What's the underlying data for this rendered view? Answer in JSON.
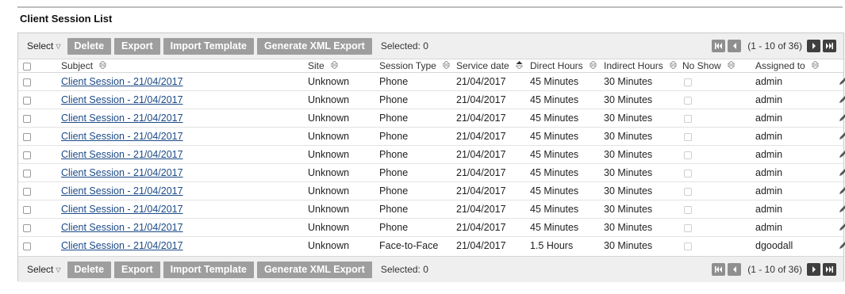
{
  "page": {
    "title": "Client Session List"
  },
  "toolbar": {
    "select_label": "Select",
    "delete_label": "Delete",
    "export_label": "Export",
    "import_label": "Import Template",
    "xml_export_label": "Generate XML Export",
    "selected_text": "Selected: 0"
  },
  "pager": {
    "range_text": "(1 - 10 of 36)"
  },
  "columns": {
    "subject": "Subject",
    "site": "Site",
    "session_type": "Session Type",
    "service_date": "Service date",
    "direct_hours": "Direct Hours",
    "indirect_hours": "Indirect Hours",
    "no_show": "No Show",
    "assigned_to": "Assigned to"
  },
  "rows": [
    {
      "subject": "Client Session - 21/04/2017",
      "site": "Unknown",
      "session_type": "Phone",
      "service_date": "21/04/2017",
      "direct_hours": "45 Minutes",
      "indirect_hours": "30 Minutes",
      "assigned_to": "admin"
    },
    {
      "subject": "Client Session - 21/04/2017",
      "site": "Unknown",
      "session_type": "Phone",
      "service_date": "21/04/2017",
      "direct_hours": "45 Minutes",
      "indirect_hours": "30 Minutes",
      "assigned_to": "admin"
    },
    {
      "subject": "Client Session - 21/04/2017",
      "site": "Unknown",
      "session_type": "Phone",
      "service_date": "21/04/2017",
      "direct_hours": "45 Minutes",
      "indirect_hours": "30 Minutes",
      "assigned_to": "admin"
    },
    {
      "subject": "Client Session - 21/04/2017",
      "site": "Unknown",
      "session_type": "Phone",
      "service_date": "21/04/2017",
      "direct_hours": "45 Minutes",
      "indirect_hours": "30 Minutes",
      "assigned_to": "admin"
    },
    {
      "subject": "Client Session - 21/04/2017",
      "site": "Unknown",
      "session_type": "Phone",
      "service_date": "21/04/2017",
      "direct_hours": "45 Minutes",
      "indirect_hours": "30 Minutes",
      "assigned_to": "admin"
    },
    {
      "subject": "Client Session - 21/04/2017",
      "site": "Unknown",
      "session_type": "Phone",
      "service_date": "21/04/2017",
      "direct_hours": "45 Minutes",
      "indirect_hours": "30 Minutes",
      "assigned_to": "admin"
    },
    {
      "subject": "Client Session - 21/04/2017",
      "site": "Unknown",
      "session_type": "Phone",
      "service_date": "21/04/2017",
      "direct_hours": "45 Minutes",
      "indirect_hours": "30 Minutes",
      "assigned_to": "admin"
    },
    {
      "subject": "Client Session - 21/04/2017",
      "site": "Unknown",
      "session_type": "Phone",
      "service_date": "21/04/2017",
      "direct_hours": "45 Minutes",
      "indirect_hours": "30 Minutes",
      "assigned_to": "admin"
    },
    {
      "subject": "Client Session - 21/04/2017",
      "site": "Unknown",
      "session_type": "Phone",
      "service_date": "21/04/2017",
      "direct_hours": "45 Minutes",
      "indirect_hours": "30 Minutes",
      "assigned_to": "admin"
    },
    {
      "subject": "Client Session - 21/04/2017",
      "site": "Unknown",
      "session_type": "Face-to-Face",
      "service_date": "21/04/2017",
      "direct_hours": "1.5 Hours",
      "indirect_hours": "30 Minutes",
      "assigned_to": "dgoodall"
    }
  ],
  "icons": {
    "sort": "sort-icon",
    "sort_active": "sort-ascending-icon",
    "edit": "pencil-icon",
    "first": "first-page-icon",
    "prev": "previous-page-icon",
    "next": "next-page-icon",
    "last": "last-page-icon",
    "select_caret": "chevron-down-icon"
  },
  "colors": {
    "toolbar_button": "#9e9e9e",
    "link": "#1c4a87",
    "pager_enabled": "#3f3f3f",
    "pager_disabled": "#8f8f8f"
  }
}
